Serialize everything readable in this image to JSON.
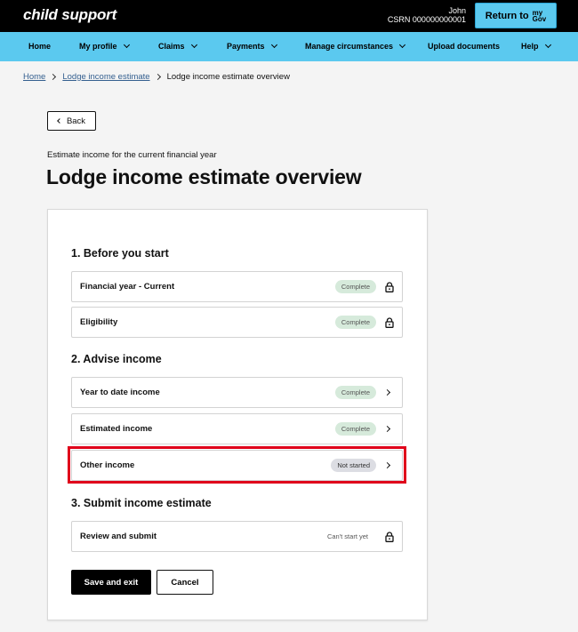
{
  "header": {
    "logo": "child support",
    "user_name": "John",
    "csrn": "CSRN 000000000001",
    "mygov_button_label": "Return to",
    "mygov_logo_line1": "my",
    "mygov_logo_line2": "Gov"
  },
  "nav": {
    "items": [
      {
        "label": "Home",
        "has_dropdown": false
      },
      {
        "label": "My profile",
        "has_dropdown": true
      },
      {
        "label": "Claims",
        "has_dropdown": true
      },
      {
        "label": "Payments",
        "has_dropdown": true
      },
      {
        "label": "Manage circumstances",
        "has_dropdown": true
      },
      {
        "label": "Upload documents",
        "has_dropdown": false
      },
      {
        "label": "Help",
        "has_dropdown": true
      }
    ]
  },
  "breadcrumb": {
    "items": [
      "Home",
      "Lodge income estimate"
    ],
    "current": "Lodge income estimate overview"
  },
  "back_button": "Back",
  "page": {
    "subtitle": "Estimate income for the current financial year",
    "title": "Lodge income estimate overview"
  },
  "sections": [
    {
      "title": "1. Before you start",
      "tasks": [
        {
          "label": "Financial year - Current",
          "status": "Complete",
          "icon": "lock-icon"
        },
        {
          "label": "Eligibility",
          "status": "Complete",
          "icon": "lock-icon"
        }
      ]
    },
    {
      "title": "2. Advise income",
      "tasks": [
        {
          "label": "Year to date income",
          "status": "Complete",
          "icon": "chevron-right-icon"
        },
        {
          "label": "Estimated income",
          "status": "Complete",
          "icon": "chevron-right-icon"
        },
        {
          "label": "Other income",
          "status": "Not started",
          "icon": "chevron-right-icon"
        }
      ]
    },
    {
      "title": "3. Submit income estimate",
      "tasks": [
        {
          "label": "Review and submit",
          "status": "Can't start yet",
          "icon": "lock-icon"
        }
      ]
    }
  ],
  "actions": {
    "save_label": "Save and exit",
    "cancel_label": "Cancel"
  },
  "colors": {
    "topbar": "#000000",
    "navbar": "#5bc9ef",
    "complete_badge": "#d6eadb",
    "not_started_badge": "#dcdde3",
    "highlight": "#e0001b"
  }
}
